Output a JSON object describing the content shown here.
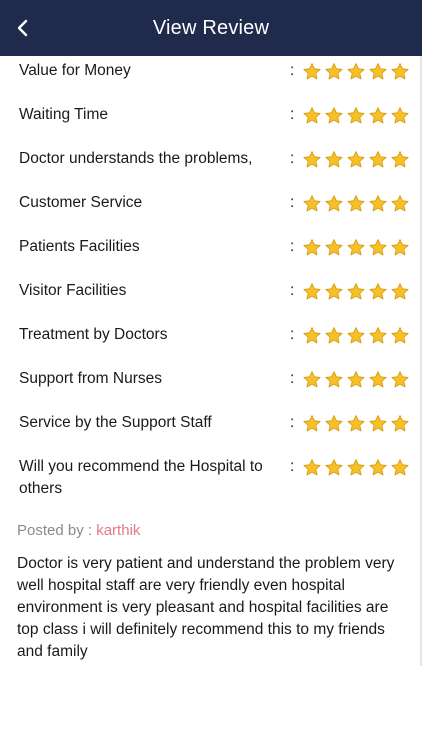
{
  "header": {
    "title": "View Review",
    "back_icon": "chevron-left-icon"
  },
  "ratings": [
    {
      "label": "Value for Money",
      "stars": 5
    },
    {
      "label": "Waiting Time",
      "stars": 5
    },
    {
      "label": "Doctor understands the problems,",
      "stars": 5
    },
    {
      "label": "Customer Service",
      "stars": 5
    },
    {
      "label": "Patients Facilities",
      "stars": 5
    },
    {
      "label": "Visitor Facilities",
      "stars": 5
    },
    {
      "label": "Treatment by Doctors",
      "stars": 5
    },
    {
      "label": "Support from Nurses",
      "stars": 5
    },
    {
      "label": "Service by the Support Staff",
      "stars": 5
    },
    {
      "label": "Will you recommend the Hospital to others",
      "stars": 5
    }
  ],
  "colon": ":",
  "posted": {
    "prefix": "Posted by : ",
    "author": "karthik"
  },
  "review_text": "Doctor is very patient and understand the problem very well hospital staff are very friendly even hospital environment is very pleasant and hospital facilities are top class i will definitely recommend this to my friends and family",
  "colors": {
    "header_bg": "#1f2a4d",
    "star_fill": "#f6c026",
    "star_stroke": "#d59a12",
    "author": "#e07a86"
  }
}
